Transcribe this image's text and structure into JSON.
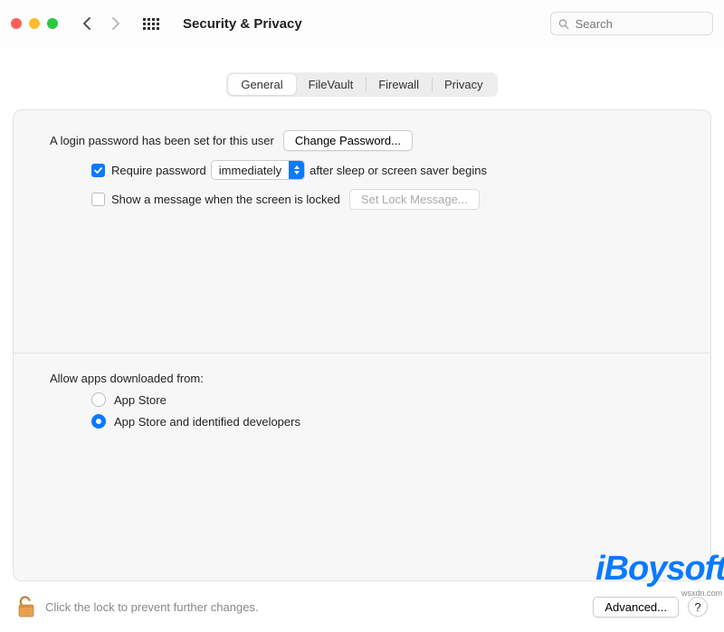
{
  "window": {
    "title": "Security & Privacy",
    "search_placeholder": "Search"
  },
  "tabs": {
    "items": [
      "General",
      "FileVault",
      "Firewall",
      "Privacy"
    ],
    "active_index": 0
  },
  "login": {
    "password_set_text": "A login password has been set for this user",
    "change_password_btn": "Change Password...",
    "require_password_label": "Require password",
    "require_password_checked": true,
    "delay_value": "immediately",
    "after_text": "after sleep or screen saver begins",
    "show_message_label": "Show a message when the screen is locked",
    "show_message_checked": false,
    "set_lock_message_btn": "Set Lock Message..."
  },
  "downloads": {
    "heading": "Allow apps downloaded from:",
    "options": [
      "App Store",
      "App Store and identified developers"
    ],
    "selected_index": 1
  },
  "footer": {
    "lock_hint": "Click the lock to prevent further changes.",
    "advanced_btn": "Advanced...",
    "help_btn": "?"
  },
  "watermark": {
    "text": "iBoysoft",
    "sub": "wsxdn.com"
  }
}
